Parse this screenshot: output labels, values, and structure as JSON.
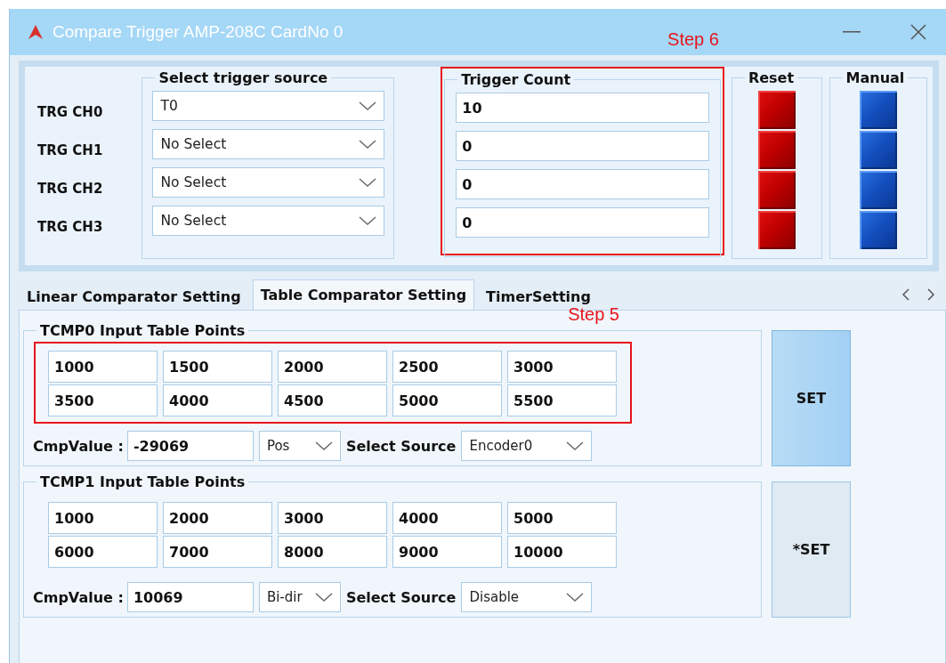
{
  "window": {
    "title": "Compare Trigger AMP-208C CardNo 0"
  },
  "trigger": {
    "source_heading": "Select trigger source",
    "count_heading": "Trigger Count",
    "reset_heading": "Reset",
    "manual_heading": "Manual",
    "annotation": "Step 6",
    "channels": [
      {
        "label": "TRG CH0",
        "source": "T0",
        "count": "10"
      },
      {
        "label": "TRG CH1",
        "source": "No Select",
        "count": "0"
      },
      {
        "label": "TRG CH2",
        "source": "No Select",
        "count": "0"
      },
      {
        "label": "TRG CH3",
        "source": "No Select",
        "count": "0"
      }
    ]
  },
  "tabs": [
    {
      "label": "Linear Comparator Setting",
      "selected": false
    },
    {
      "label": "Table Comparator Setting",
      "selected": true
    },
    {
      "label": "TimerSetting",
      "selected": false
    }
  ],
  "tables": [
    {
      "heading": "TCMP0 Input Table Points",
      "annotation": "Step 5",
      "points": [
        "1000",
        "1500",
        "2000",
        "2500",
        "3000",
        "3500",
        "4000",
        "4500",
        "5000",
        "5500"
      ],
      "cmp_label": "CmpValue :",
      "cmp_value": "-29069",
      "direction": "Pos",
      "source_label": "Select Source",
      "source": "Encoder0",
      "set_button": {
        "label": "SET",
        "highlighted": true
      }
    },
    {
      "heading": "TCMP1 Input Table Points",
      "points": [
        "1000",
        "2000",
        "3000",
        "4000",
        "5000",
        "6000",
        "7000",
        "8000",
        "9000",
        "10000"
      ],
      "cmp_label": "CmpValue :",
      "cmp_value": "10069",
      "direction": "Bi-dir",
      "source_label": "Select Source",
      "source": "Disable",
      "set_button": {
        "label": "*SET",
        "highlighted": false
      }
    }
  ]
}
